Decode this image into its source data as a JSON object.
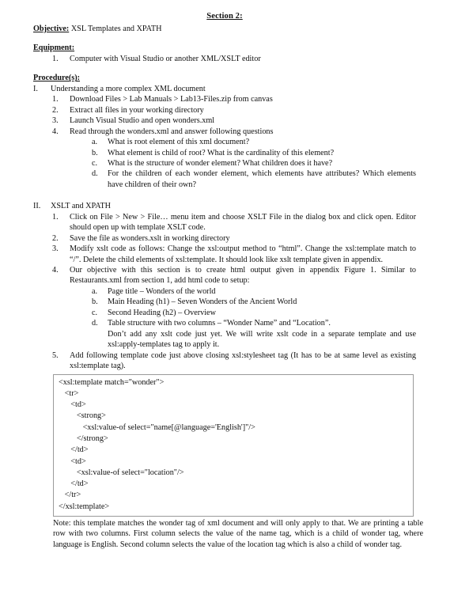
{
  "document": {
    "heading": "Section 2:",
    "objective": {
      "label": "Objective:",
      "text": " XSL Templates and XPATH"
    },
    "equipment": {
      "label": "Equipment:",
      "items": [
        {
          "marker": "1.",
          "text": "Computer with Visual Studio or another XML/XSLT editor"
        }
      ]
    },
    "procedures": {
      "label": "Procedure(s):",
      "section_one": {
        "marker": "I.",
        "title": "Understanding a more complex XML document",
        "steps": [
          {
            "marker": "1.",
            "text": "Download Files > Lab Manuals > Lab13-Files.zip from canvas"
          },
          {
            "marker": "2.",
            "text": "Extract all files in your working directory"
          },
          {
            "marker": "3.",
            "text": "Launch Visual Studio and open wonders.xml"
          },
          {
            "marker": "4.",
            "text": "Read through the wonders.xml and answer following questions"
          }
        ],
        "questions": [
          {
            "marker": "a.",
            "text": "What is root element of this xml document?"
          },
          {
            "marker": "b.",
            "text": "What element is child of root? What is the cardinality of this element?"
          },
          {
            "marker": "c.",
            "text": "What is the structure of wonder element? What children does it have?"
          },
          {
            "marker": "d.",
            "text": "For the children of each wonder element, which elements have attributes? Which elements have children of their own?"
          }
        ]
      },
      "section_two": {
        "marker": "II.",
        "title": "XSLT and XPATH",
        "steps": [
          {
            "marker": "1.",
            "text": "Click on File > New > File… menu item and choose XSLT File in the dialog box and click open. Editor should open up with template XSLT code."
          },
          {
            "marker": "2.",
            "text": "Save the file as wonders.xslt in working directory"
          },
          {
            "marker": "3.",
            "text": "Modify xslt  code as follows: Change the xsl:output method to “html”. Change the xsl:template match to “/”. Delete the child elements of xsl:template. It should look like xslt template given in appendix."
          },
          {
            "marker": "4.",
            "text": "Our objective with this section is to create html output given in appendix Figure 1. Similar to Restaurants.xml from section 1, add html code to setup:"
          },
          {
            "marker": "5.",
            "text": "Add following template code just above closing xsl:stylesheet tag (It has to be at same level as existing xsl:template tag)."
          }
        ],
        "setup_items": [
          {
            "marker": "a.",
            "text": "Page title – Wonders of the world"
          },
          {
            "marker": "b.",
            "text": "Main Heading (h1) – Seven Wonders of the Ancient World"
          },
          {
            "marker": "c.",
            "text": "Second Heading (h2) – Overview"
          },
          {
            "marker": "d.",
            "text": "Table structure with two columns – “Wonder Name” and “Location”."
          }
        ],
        "setup_note": "Don’t add any xslt code just yet. We will write xslt code in a separate template and use xsl:apply-templates tag to apply it."
      }
    },
    "code_block": "<xsl:template match=\"wonder\">\n   <tr>\n      <td>\n         <strong>\n            <xsl:value-of select=\"name[@language='English']\"/>\n         </strong>\n      </td>\n      <td>\n         <xsl:value-of select=\"location\"/>\n      </td>\n   </tr>\n</xsl:template>",
    "closing_note": "Note: this template matches the wonder tag of xml document and will only apply to that. We are printing a table row with two columns. First column selects the value of the name tag, which is a child of wonder tag, where language is English. Second column selects the value of the location tag which is also a child of wonder tag."
  }
}
